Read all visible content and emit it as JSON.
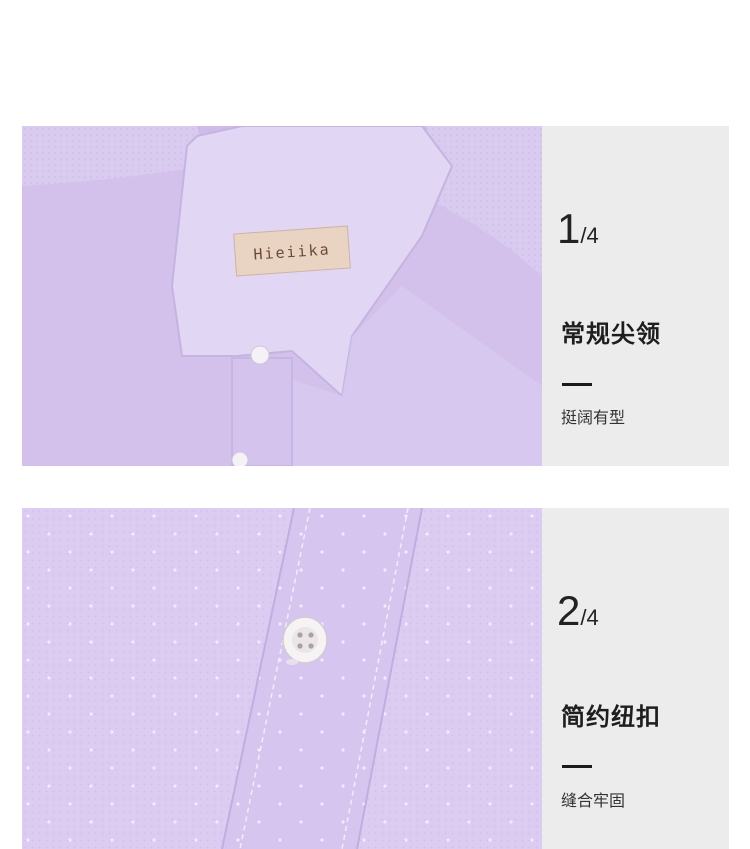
{
  "features": [
    {
      "index": "1",
      "total": "/4",
      "title": "常规尖领",
      "subtitle": "挺阔有型"
    },
    {
      "index": "2",
      "total": "/4",
      "title": "简约纽扣",
      "subtitle": "缝合牢固"
    }
  ],
  "label": {
    "brand": "Hieiika"
  },
  "colors": {
    "shirt": "#d8c8ef",
    "panel_bg": "#ececec",
    "accent_bar": "#1a1a1a"
  }
}
